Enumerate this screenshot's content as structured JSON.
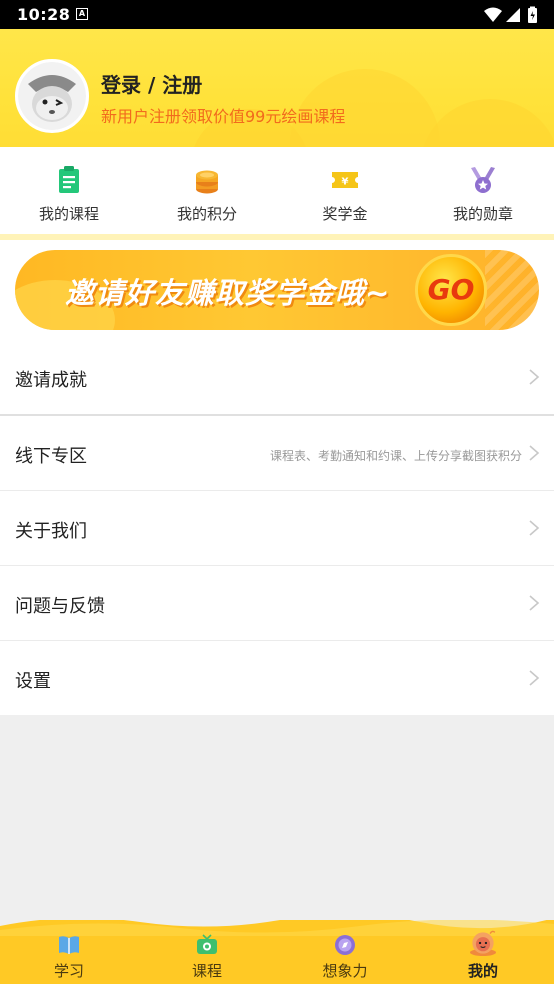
{
  "status_bar": {
    "time": "10:28",
    "notification_icon": "A"
  },
  "profile": {
    "title": "登录 / 注册",
    "subtitle": "新用户注册领取价值99元绘画课程"
  },
  "quick_entries": [
    {
      "label": "我的课程",
      "icon": "clipboard-icon",
      "color": "#2ecc71"
    },
    {
      "label": "我的积分",
      "icon": "coin-stack-icon",
      "color": "#f39c12"
    },
    {
      "label": "奖学金",
      "icon": "ticket-icon",
      "color": "#f1c40f"
    },
    {
      "label": "我的勋章",
      "icon": "medal-icon",
      "color": "#9b7fd1"
    }
  ],
  "banner": {
    "text": "邀请好友赚取奖学金哦~",
    "go_label": "GO"
  },
  "menu": [
    {
      "label": "邀请成就",
      "hint": ""
    },
    {
      "label": "线下专区",
      "hint": "课程表、考勤通知和约课、上传分享截图获积分"
    },
    {
      "label": "关于我们",
      "hint": ""
    },
    {
      "label": "问题与反馈",
      "hint": ""
    },
    {
      "label": "设置",
      "hint": ""
    }
  ],
  "tabs": [
    {
      "label": "学习",
      "icon": "book-icon",
      "active": false
    },
    {
      "label": "课程",
      "icon": "tv-icon",
      "active": false
    },
    {
      "label": "想象力",
      "icon": "compass-icon",
      "active": false
    },
    {
      "label": "我的",
      "icon": "snail-icon",
      "active": true
    }
  ],
  "colors": {
    "header_yellow": "#ffe23a",
    "subtitle_orange": "#f26b1d",
    "tabbar_yellow": "#ffc925"
  }
}
